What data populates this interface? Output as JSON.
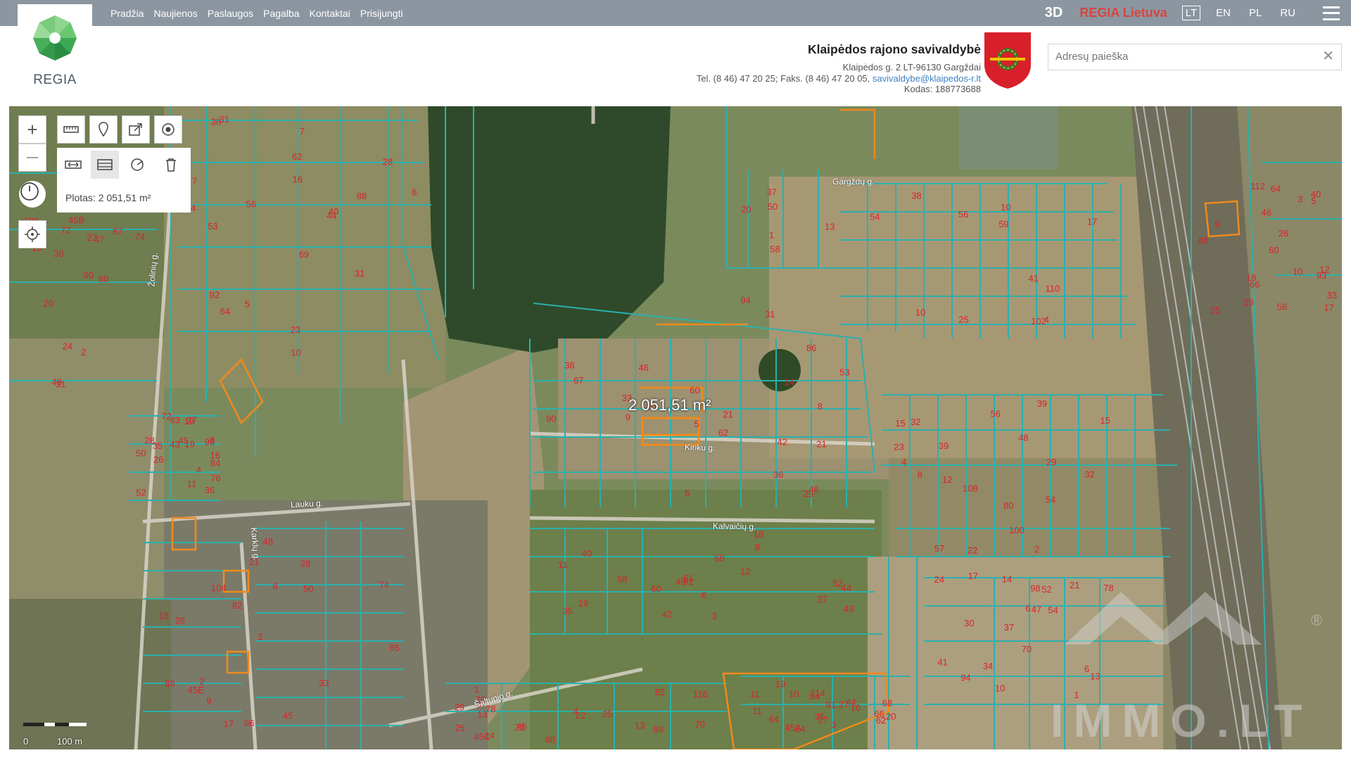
{
  "nav": {
    "items": [
      "Pradžia",
      "Naujienos",
      "Paslaugos",
      "Pagalba",
      "Kontaktai",
      "Prisijungti"
    ]
  },
  "topright": {
    "btn_3d": "3D",
    "regia_lt": "REGIA Lietuva",
    "languages": [
      "LT",
      "EN",
      "PL",
      "RU"
    ],
    "active_language": "LT"
  },
  "logo": {
    "text": "REGIA"
  },
  "municipality": {
    "name": "Klaipėdos rajono savivaldybė",
    "address": "Klaipėdos g. 2 LT-96130 Gargždai",
    "phone": "Tel. (8 46) 47 20 25; Faks. (8 46) 47 20 05, ",
    "email": "savivaldybe@klaipedos-r.lt",
    "code": "Kodas: 188773688"
  },
  "search": {
    "placeholder": "Adresų paieška",
    "clear_symbol": "✕"
  },
  "tools": {
    "zoom_in": "+",
    "zoom_out": "—",
    "area_label": "Plotas: 2 051,51 m²"
  },
  "map": {
    "measure_label": "2 051,51 m²",
    "scale_zero": "0",
    "scale_distance": "100 m",
    "roads": [
      "Kiriku g.",
      "Kalvaičių g.",
      "Lauku g.",
      "Karklų g.",
      "Šaltupio g.",
      "Žolinių g.",
      "Gargždų g."
    ],
    "watermark": "IMMO.LT",
    "watermark_mark": "®",
    "colors": {
      "parcel": "#29a8a8",
      "highlight": "#f08a1c",
      "labels": "#d8242a"
    },
    "parcel_labels": [
      "69",
      "67",
      "61",
      "31",
      "29",
      "10",
      "27",
      "8",
      "23",
      "25",
      "19",
      "17",
      "53",
      "53",
      "49",
      "59",
      "57",
      "47",
      "45",
      "45E",
      "45B",
      "45C",
      "45A",
      "46",
      "44",
      "42",
      "40",
      "38",
      "4",
      "6",
      "8",
      "2",
      "2",
      "4",
      "10",
      "3",
      "5",
      "46",
      "43",
      "41",
      "39",
      "37",
      "35",
      "33",
      "31",
      "29",
      "27",
      "25",
      "23",
      "21",
      "19",
      "17",
      "15",
      "13",
      "11",
      "9",
      "7",
      "1",
      "3",
      "5",
      "7",
      "9",
      "11",
      "13",
      "15",
      "17",
      "19",
      "21",
      "23",
      "25",
      "27",
      "29",
      "31",
      "33",
      "35",
      "37",
      "39",
      "41",
      "43",
      "45",
      "47",
      "14",
      "16",
      "12",
      "10",
      "8",
      "6",
      "4",
      "2",
      "1",
      "83",
      "85",
      "87",
      "89",
      "91",
      "93",
      "4",
      "6",
      "8",
      "10",
      "12",
      "14",
      "16",
      "18",
      "20",
      "22",
      "24",
      "26",
      "28",
      "30",
      "52",
      "50",
      "48",
      "70",
      "72",
      "88",
      "90",
      "116",
      "114",
      "112",
      "92",
      "86",
      "68",
      "54",
      "32",
      "34",
      "36",
      "66",
      "74",
      "76",
      "64",
      "58",
      "56",
      "46",
      "44",
      "110",
      "108",
      "94",
      "84",
      "82",
      "80",
      "78",
      "62",
      "60",
      "40",
      "38",
      "42",
      "102",
      "100",
      "98",
      "96",
      "104",
      "106",
      "68",
      "66",
      "64",
      "62",
      "60",
      "58",
      "56",
      "54",
      "52",
      "50",
      "48",
      "39",
      "37",
      "35",
      "33",
      "31",
      "29",
      "27",
      "25",
      "23",
      "21",
      "19",
      "17",
      "15",
      "13",
      "11",
      "9",
      "7",
      "5",
      "3",
      "1",
      "32",
      "30",
      "28",
      "26",
      "24",
      "22",
      "20",
      "18",
      "16",
      "14",
      "12",
      "10",
      "8",
      "6",
      "4",
      "2",
      "19",
      "82",
      "84",
      "86",
      "88",
      "90",
      "92",
      "94",
      "80",
      "78",
      "76",
      "74",
      "72",
      "70",
      "68",
      "66",
      "64",
      "62",
      "60",
      "58",
      "56",
      "54",
      "52",
      "50",
      "48",
      "46",
      "44",
      "40",
      "38",
      "36",
      "18",
      "20",
      "22",
      "24",
      "26",
      "28",
      "30",
      "13",
      "11",
      "10",
      "8",
      "21"
    ]
  }
}
